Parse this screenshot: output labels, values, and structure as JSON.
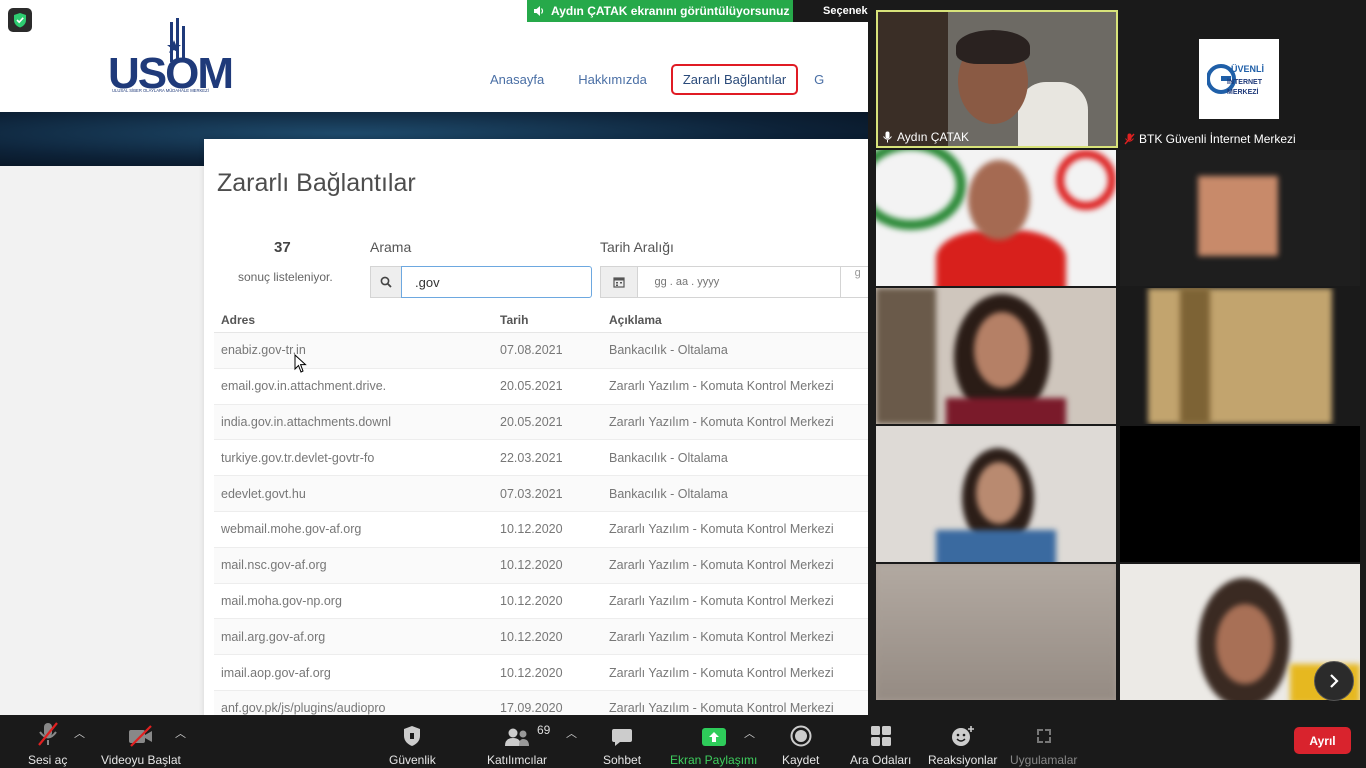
{
  "website": {
    "logo_text": "USOM",
    "logo_subtext": "ULUSAL SİBER OLAYLARA MÜDAHALE MERKEZİ",
    "nav": [
      {
        "label": "Anasayfa"
      },
      {
        "label": "Hakkımızda"
      },
      {
        "label": "Zararlı Bağlantılar"
      },
      {
        "label": "G"
      }
    ],
    "page_title": "Zararlı Bağlantılar",
    "result_count": "37",
    "result_label": "sonuç listeleniyor.",
    "search_label": "Arama",
    "search_value": ".gov",
    "date_label": "Tarih Aralığı",
    "date_placeholder": "gg . aa . yyyy",
    "date_placeholder2": "g",
    "columns": {
      "address": "Adres",
      "date": "Tarih",
      "description": "Açıklama"
    },
    "rows": [
      {
        "address": "enabiz.gov-tr.in",
        "date": "07.08.2021",
        "description": "Bankacılık - Oltalama"
      },
      {
        "address": "email.gov.in.attachment.drive.",
        "date": "20.05.2021",
        "description": "Zararlı Yazılım - Komuta Kontrol Merkezi"
      },
      {
        "address": "india.gov.in.attachments.downl",
        "date": "20.05.2021",
        "description": "Zararlı Yazılım - Komuta Kontrol Merkezi"
      },
      {
        "address": "turkiye.gov.tr.devlet-govtr-fo",
        "date": "22.03.2021",
        "description": "Bankacılık - Oltalama"
      },
      {
        "address": "edevlet.govt.hu",
        "date": "07.03.2021",
        "description": "Bankacılık - Oltalama"
      },
      {
        "address": "webmail.mohe.gov-af.org",
        "date": "10.12.2020",
        "description": "Zararlı Yazılım - Komuta Kontrol Merkezi"
      },
      {
        "address": "mail.nsc.gov-af.org",
        "date": "10.12.2020",
        "description": "Zararlı Yazılım - Komuta Kontrol Merkezi"
      },
      {
        "address": "mail.moha.gov-np.org",
        "date": "10.12.2020",
        "description": "Zararlı Yazılım - Komuta Kontrol Merkezi"
      },
      {
        "address": "mail.arg.gov-af.org",
        "date": "10.12.2020",
        "description": "Zararlı Yazılım - Komuta Kontrol Merkezi"
      },
      {
        "address": "imail.aop.gov-af.org",
        "date": "10.12.2020",
        "description": "Zararlı Yazılım - Komuta Kontrol Merkezi"
      },
      {
        "address": "anf.gov.pk/js/plugins/audiopro",
        "date": "17.09.2020",
        "description": "Zararlı Yazılım - Komuta Kontrol Merkezi"
      }
    ]
  },
  "zoom": {
    "share_banner": "Aydın ÇATAK ekranını görüntülüyorsunuz",
    "options_label": "Seçenekl",
    "participants": [
      {
        "name": "Aydın ÇATAK"
      },
      {
        "name": "BTK Güvenli İnternet Merkezi"
      }
    ],
    "gim_logo": "GÜVENLİ İNTERNET MERKEZİ",
    "toolbar": {
      "unmute": "Sesi aç",
      "start_video": "Videoyu Başlat",
      "security": "Güvenlik",
      "participants": "Katılımcılar",
      "participant_count": "69",
      "chat": "Sohbet",
      "share_screen": "Ekran Paylaşımı",
      "record": "Kaydet",
      "breakout": "Ara Odaları",
      "reactions": "Reaksiyonlar",
      "apps": "Uygulamalar",
      "leave": "Ayrıl"
    }
  },
  "colors": {
    "share_green": "#26a94a",
    "leave_red": "#d9232d",
    "nav_active_border": "#e01b24",
    "logo_navy": "#1f3a7a",
    "speaker_border": "#d8e37a"
  }
}
